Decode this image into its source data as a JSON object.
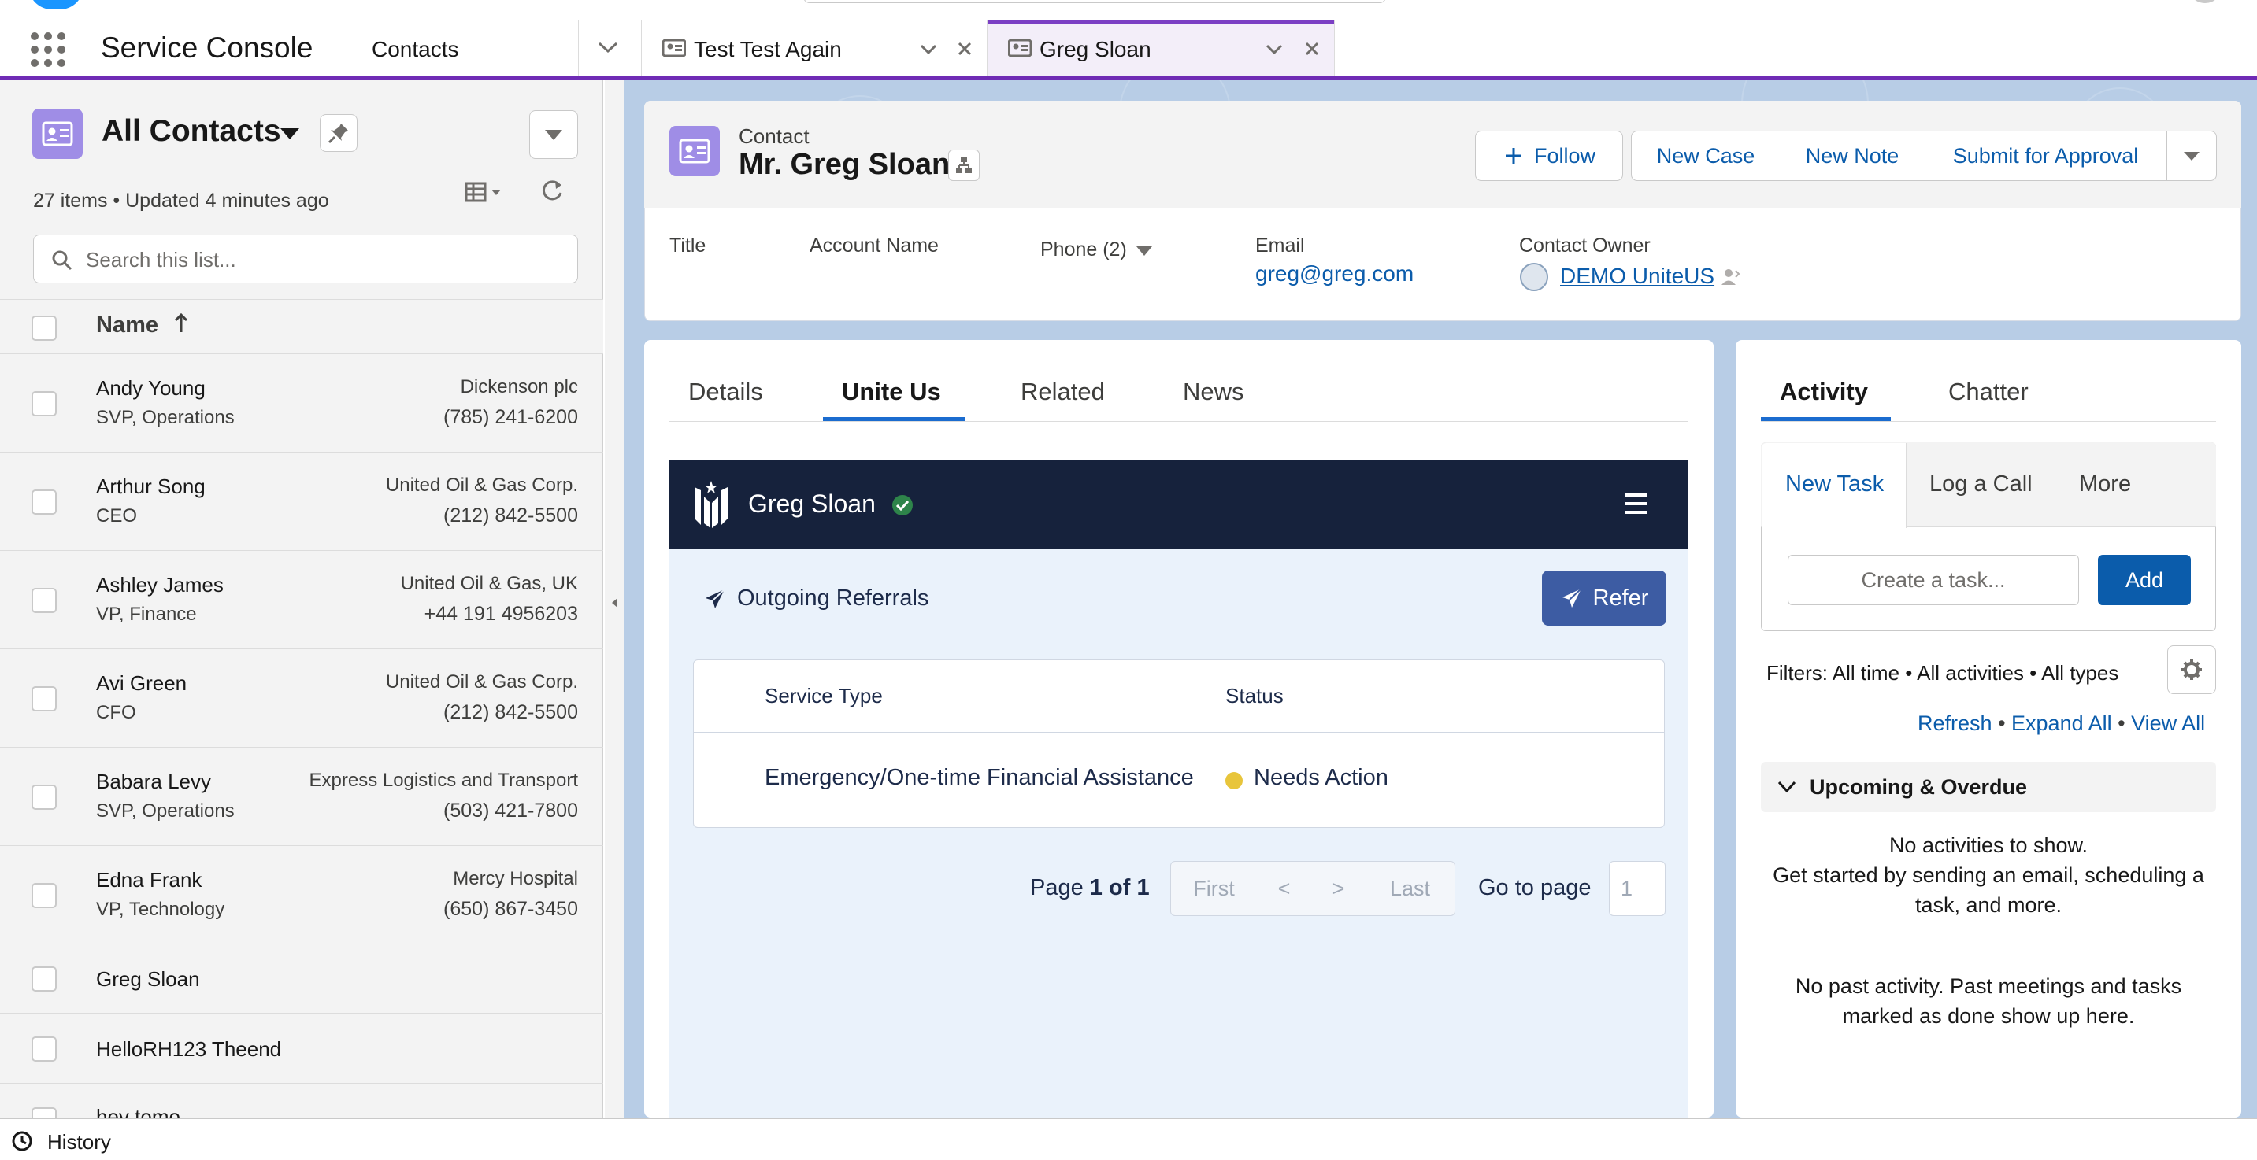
{
  "app": {
    "title": "Service Console"
  },
  "nav": {
    "object": "Contacts",
    "tabs": [
      {
        "label": "Test Test Again"
      },
      {
        "label": "Greg Sloan"
      }
    ]
  },
  "list": {
    "title": "All Contacts",
    "meta": "27 items • Updated 4 minutes ago",
    "search_placeholder": "Search this list...",
    "column_name": "Name",
    "rows": [
      {
        "name": "Andy Young",
        "title": "SVP, Operations",
        "account": "Dickenson plc",
        "phone": "(785) 241-6200"
      },
      {
        "name": "Arthur Song",
        "title": "CEO",
        "account": "United Oil & Gas Corp.",
        "phone": "(212) 842-5500"
      },
      {
        "name": "Ashley James",
        "title": "VP, Finance",
        "account": "United Oil & Gas, UK",
        "phone": "+44 191 4956203"
      },
      {
        "name": "Avi Green",
        "title": "CFO",
        "account": "United Oil & Gas Corp.",
        "phone": "(212) 842-5500"
      },
      {
        "name": "Babara Levy",
        "title": "SVP, Operations",
        "account": "Express Logistics and Transport",
        "phone": "(503) 421-7800"
      },
      {
        "name": "Edna Frank",
        "title": "VP, Technology",
        "account": "Mercy Hospital",
        "phone": "(650) 867-3450"
      },
      {
        "name": "Greg Sloan"
      },
      {
        "name": "HelloRH123 Theend"
      },
      {
        "name": "hey tomo"
      }
    ]
  },
  "record": {
    "type": "Contact",
    "name": "Mr. Greg Sloan",
    "actions": {
      "follow": "Follow",
      "new_case": "New Case",
      "new_note": "New Note",
      "submit": "Submit for Approval"
    },
    "fields": {
      "title_label": "Title",
      "account_label": "Account Name",
      "phone_label": "Phone (2)",
      "email_label": "Email",
      "email_value": "greg@greg.com",
      "owner_label": "Contact Owner",
      "owner_value": "DEMO UniteUS"
    }
  },
  "tabs": {
    "details": "Details",
    "unite_us": "Unite Us",
    "related": "Related",
    "news": "News"
  },
  "uniteus": {
    "person": "Greg Sloan",
    "section": "Outgoing Referrals",
    "refer_button": "Refer",
    "columns": {
      "service_type": "Service Type",
      "status": "Status"
    },
    "referrals": [
      {
        "service_type": "Emergency/One-time Financial Assistance",
        "status": "Needs Action",
        "status_color": "#e8c53b"
      }
    ],
    "pager": {
      "page_prefix": "Page",
      "page_current": "1",
      "of": "of",
      "page_total": "1",
      "first": "First",
      "prev": "<",
      "next": ">",
      "last": "Last",
      "goto": "Go to page",
      "goto_value": "1"
    }
  },
  "activity": {
    "tab_activity": "Activity",
    "tab_chatter": "Chatter",
    "new_task": "New Task",
    "log_call": "Log a Call",
    "more": "More",
    "task_placeholder": "Create a task...",
    "add": "Add",
    "filters": "Filters: All time • All activities • All types",
    "refresh": "Refresh",
    "expand_all": "Expand All",
    "view_all": "View All",
    "dot": "•",
    "upcoming": "Upcoming & Overdue",
    "no_activities": "No activities to show.",
    "get_started": "Get started by sending an email, scheduling a task, and more.",
    "no_past": "No past activity. Past meetings and tasks marked as done show up here."
  },
  "footer": {
    "history": "History"
  },
  "colors": {
    "accent_purple": "#6f2bb5",
    "link_blue": "#0b5cab",
    "brand_blue": "#1b6ccf",
    "uniteus_navy": "#16223c",
    "refer_button": "#3d5ca3",
    "verified_green": "#2e844a"
  }
}
